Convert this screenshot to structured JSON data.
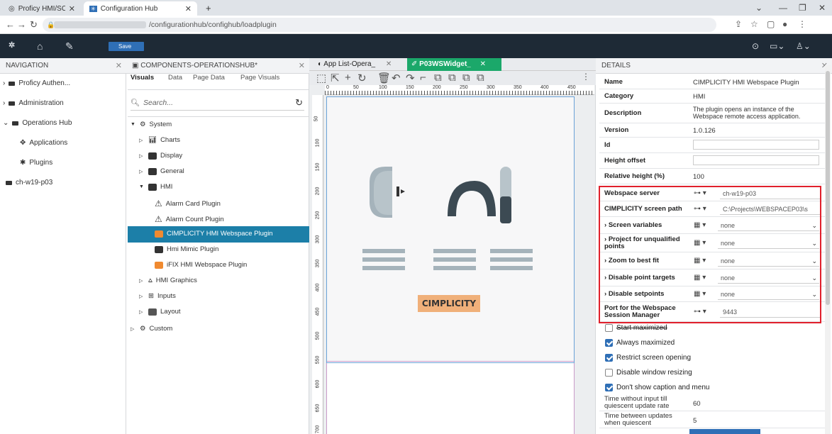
{
  "browser": {
    "tabs": [
      {
        "label": "Proficy HMI/SCADA CIMPLIC",
        "active": false
      },
      {
        "label": "Configuration Hub",
        "active": true
      }
    ],
    "new_tab": "+",
    "url": "/configurationhub/confighub/loadplugin"
  },
  "app_header": {
    "save_label": "Save"
  },
  "navigation": {
    "title": "NAVIGATION",
    "items": [
      {
        "label": "Proficy Authen..."
      },
      {
        "label": "Administration"
      },
      {
        "label": "Operations Hub"
      },
      {
        "label": "Applications"
      },
      {
        "label": "Plugins"
      },
      {
        "label": "ch-w19-p03"
      }
    ]
  },
  "components": {
    "title": "COMPONENTS-OPERATIONSHUB*",
    "tabs": [
      "Visuals",
      "Data",
      "Page Data",
      "Page Visuals"
    ],
    "search_placeholder": "Search...",
    "tree": [
      {
        "label": "System"
      },
      {
        "label": "Charts"
      },
      {
        "label": "Display"
      },
      {
        "label": "General"
      },
      {
        "label": "HMI"
      },
      {
        "label": "Alarm Card Plugin"
      },
      {
        "label": "Alarm Count Plugin"
      },
      {
        "label": "CIMPLICITY HMI Webspace Plugin"
      },
      {
        "label": "Hmi Mimic Plugin"
      },
      {
        "label": "iFIX HMI Webspace Plugin"
      },
      {
        "label": "HMI Graphics"
      },
      {
        "label": "Inputs"
      },
      {
        "label": "Layout"
      },
      {
        "label": "Custom"
      }
    ]
  },
  "canvas": {
    "tabs": [
      {
        "label": "App List-Opera_"
      },
      {
        "label": "P03WSWidget_"
      }
    ],
    "ruler_h": [
      "0",
      "50",
      "100",
      "150",
      "200",
      "250",
      "300",
      "350",
      "400",
      "450"
    ],
    "ruler_v": [
      "50",
      "100",
      "150",
      "200",
      "250",
      "300",
      "350",
      "400",
      "450",
      "500",
      "550",
      "600",
      "650",
      "700"
    ],
    "widget_label": "CIMPLICITY"
  },
  "details": {
    "title": "DETAILS",
    "rows": [
      {
        "label": "Name",
        "value": "CIMPLICITY HMI Webspace Plugin"
      },
      {
        "label": "Category",
        "value": "HMI"
      },
      {
        "label": "Description",
        "value": "The plugin opens an instance of the Webspace remote access application."
      },
      {
        "label": "Version",
        "value": "1.0.126"
      },
      {
        "label": "Id",
        "value": ""
      },
      {
        "label": "Height offset",
        "value": ""
      },
      {
        "label": "Relative height (%)",
        "value": "100"
      }
    ],
    "bound_rows": [
      {
        "label": "Webspace server",
        "value": "ch-w19-p03"
      },
      {
        "label": "CIMPLICITY screen path",
        "value": "C:\\Projects\\WEBSPACEP03\\s"
      },
      {
        "label": "Screen variables",
        "value": "none"
      },
      {
        "label": "Project for unqualified points",
        "value": "none"
      },
      {
        "label": "Zoom to best fit",
        "value": "none"
      },
      {
        "label": "Disable point targets",
        "value": "none"
      },
      {
        "label": "Disable setpoints",
        "value": "none"
      },
      {
        "label": "Port for the Webspace Session Manager",
        "value": "9443"
      }
    ],
    "checkboxes": [
      {
        "label": "Start maximized",
        "checked": false
      },
      {
        "label": "Always maximized",
        "checked": true
      },
      {
        "label": "Restrict screen opening",
        "checked": true
      },
      {
        "label": "Disable window resizing",
        "checked": false
      },
      {
        "label": "Don't show caption and menu",
        "checked": true
      }
    ],
    "tail_rows": [
      {
        "label": "Time without input till quiescent update rate",
        "value": "60"
      },
      {
        "label": "Time between updates when quiescent",
        "value": "5"
      }
    ]
  },
  "colors": {
    "header_bg": "#1e2a36",
    "selection": "#1c7fa8",
    "highlight_border": "#e0202c",
    "accent": "#2f6fb6"
  }
}
